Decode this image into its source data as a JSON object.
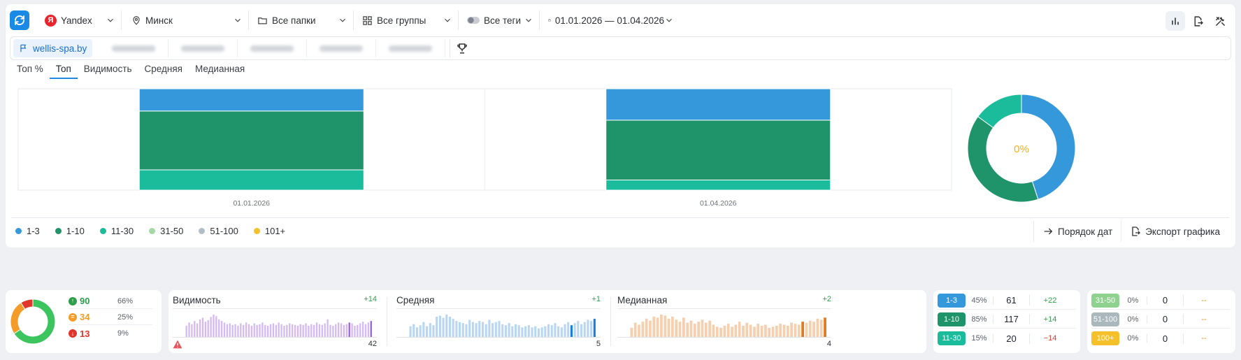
{
  "filters": {
    "engine": "Yandex",
    "region": "Минск",
    "folders": "Все папки",
    "groups": "Все группы",
    "tags": "Все теги",
    "date_range": "01.01.2026 — 01.04.2026"
  },
  "domains": {
    "active": "wellis-spa.by"
  },
  "tabs": [
    "Топ %",
    "Топ",
    "Видимость",
    "Средняя",
    "Медианная"
  ],
  "active_tab": "Топ",
  "chart_data": [
    {
      "type": "bar",
      "stacked": true,
      "categories": [
        "01.01.2026",
        "01.04.2026"
      ],
      "series": [
        {
          "name": "1-3",
          "color": "#3498db",
          "values": [
            22,
            31
          ]
        },
        {
          "name": "1-10",
          "color": "#1f936a",
          "values": [
            58,
            59
          ]
        },
        {
          "name": "11-30",
          "color": "#1abc9c",
          "values": [
            20,
            10
          ]
        },
        {
          "name": "31-50",
          "color": "#a3d9a5",
          "values": [
            0,
            0
          ]
        },
        {
          "name": "51-100",
          "color": "#b0bec5",
          "values": [
            0,
            0
          ]
        },
        {
          "name": "101+",
          "color": "#f5c02a",
          "values": [
            0,
            0
          ]
        }
      ],
      "ylim": [
        0,
        100
      ],
      "grid": true
    },
    {
      "type": "pie",
      "donut": true,
      "center_label": "0%",
      "slices": [
        {
          "name": "1-3",
          "color": "#3498db",
          "value": 45
        },
        {
          "name": "1-10",
          "color": "#1f936a",
          "value": 40
        },
        {
          "name": "11-30",
          "color": "#1abc9c",
          "value": 15
        }
      ]
    }
  ],
  "legend": [
    {
      "label": "1-3",
      "color": "#3498db"
    },
    {
      "label": "1-10",
      "color": "#1f936a"
    },
    {
      "label": "11-30",
      "color": "#1abc9c"
    },
    {
      "label": "31-50",
      "color": "#a3d9a5"
    },
    {
      "label": "51-100",
      "color": "#b0bec5"
    },
    {
      "label": "101+",
      "color": "#f5c02a"
    }
  ],
  "actions": {
    "date_order": "Порядок дат",
    "export": "Экспорт графика"
  },
  "summary": {
    "rows": [
      {
        "value": "90",
        "percent": "66%",
        "color": "#2e9e4b",
        "icon": "arrow-up-icon"
      },
      {
        "value": "34",
        "percent": "25%",
        "color": "#f39c2a",
        "icon": "equal-icon"
      },
      {
        "value": "13",
        "percent": "9%",
        "color": "#e0352b",
        "icon": "arrow-down-icon"
      }
    ],
    "donut": [
      {
        "value": 66,
        "color": "#3cc45e"
      },
      {
        "value": 25,
        "color": "#f39c2a"
      },
      {
        "value": 9,
        "color": "#e0352b"
      }
    ]
  },
  "metrics": [
    {
      "title": "Видимость",
      "delta": "+14",
      "value": "42",
      "bar_color": "#d4b9f2",
      "last_color": "#9b5de5",
      "warning": true,
      "bars": [
        14,
        18,
        16,
        20,
        17,
        22,
        24,
        19,
        21,
        25,
        28,
        26,
        22,
        20,
        18,
        16,
        17,
        15,
        16,
        14,
        17,
        15,
        18,
        16,
        14,
        17,
        15,
        16,
        18,
        15,
        14,
        16,
        17,
        15,
        18,
        16,
        14,
        15,
        17,
        16,
        15,
        14,
        16,
        15,
        17,
        14,
        16,
        15,
        18,
        16,
        15,
        17,
        22,
        15,
        14,
        16,
        18,
        17,
        15,
        16,
        18,
        17,
        14,
        15,
        17,
        19,
        16,
        18,
        20
      ]
    },
    {
      "title": "Средняя",
      "delta": "+1",
      "value": "5",
      "bar_color": "#b9d7f2",
      "last_color": "#1b7de0",
      "warning": false,
      "bars": [
        10,
        12,
        9,
        11,
        14,
        10,
        13,
        11,
        19,
        20,
        18,
        21,
        19,
        17,
        15,
        14,
        13,
        12,
        16,
        14,
        13,
        15,
        14,
        12,
        16,
        13,
        14,
        15,
        12,
        11,
        13,
        10,
        12,
        11,
        9,
        10,
        11,
        9,
        10,
        8,
        9,
        10,
        12,
        11,
        13,
        10,
        9,
        12,
        14,
        11,
        13,
        15,
        12,
        14,
        16,
        15,
        17
      ]
    },
    {
      "title": "Медианная",
      "delta": "+2",
      "value": "4",
      "bar_color": "#f6cfae",
      "last_color": "#e07a1f",
      "warning": false,
      "bars": [
        9,
        14,
        12,
        15,
        18,
        16,
        20,
        19,
        22,
        21,
        18,
        20,
        17,
        15,
        19,
        14,
        16,
        13,
        15,
        17,
        14,
        16,
        12,
        10,
        9,
        11,
        13,
        10,
        12,
        15,
        11,
        14,
        12,
        10,
        13,
        11,
        12,
        9,
        10,
        11,
        13,
        12,
        11,
        14,
        13,
        12,
        15,
        14,
        16,
        15,
        18,
        17,
        19
      ]
    }
  ],
  "positions": [
    {
      "label": "1-3",
      "color": "#3498db",
      "percent": "45%",
      "count": "61",
      "delta": "+22",
      "tone": "pos"
    },
    {
      "label": "1-10",
      "color": "#1f936a",
      "percent": "85%",
      "count": "117",
      "delta": "+14",
      "tone": "pos"
    },
    {
      "label": "11-30",
      "color": "#1abc9c",
      "percent": "15%",
      "count": "20",
      "delta": "−14",
      "tone": "neg"
    },
    {
      "label": "31-50",
      "color": "#8fd18f",
      "percent": "0%",
      "count": "0",
      "delta": "--",
      "tone": "neu"
    },
    {
      "label": "51-100",
      "color": "#aab7bd",
      "percent": "0%",
      "count": "0",
      "delta": "--",
      "tone": "neu"
    },
    {
      "label": "100+",
      "color": "#f5c02a",
      "percent": "0%",
      "count": "0",
      "delta": "--",
      "tone": "neu"
    }
  ]
}
